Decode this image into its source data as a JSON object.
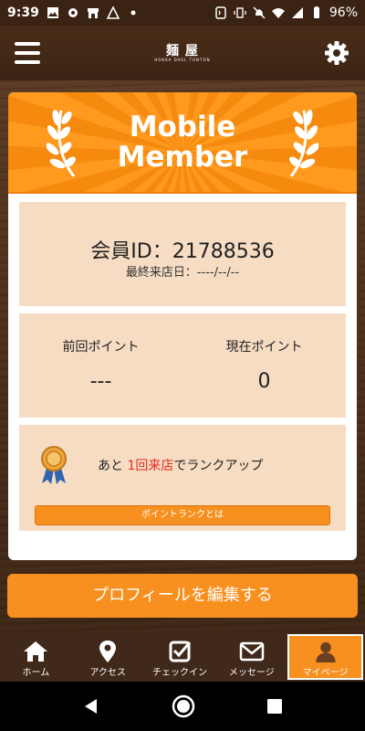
{
  "status_bar": {
    "time": "9:39",
    "battery": "96%"
  },
  "header": {
    "logo_main": "麺 屋",
    "logo_sub": "HOKKA DASL TONTON"
  },
  "banner": {
    "title_line1": "Mobile",
    "title_line2": "Member"
  },
  "member": {
    "id_text": "会員ID：21788536",
    "last_visit": "最終来店日：----/--/--"
  },
  "points": {
    "previous_label": "前回ポイント",
    "previous_value": "---",
    "current_label": "現在ポイント",
    "current_value": "0"
  },
  "rank": {
    "text_before": "あと ",
    "text_highlight": "1回来店",
    "text_after": "でランクアップ",
    "button_label": "ポイントランクとは"
  },
  "edit_profile_label": "プロフィールを編集する",
  "bottom_nav": {
    "items": [
      {
        "label": "ホーム",
        "icon": "home-icon"
      },
      {
        "label": "アクセス",
        "icon": "map-pin-icon"
      },
      {
        "label": "チェックイン",
        "icon": "checkbox-icon"
      },
      {
        "label": "メッセージ",
        "icon": "mail-icon"
      },
      {
        "label": "マイページ",
        "icon": "user-icon"
      }
    ],
    "active_index": 4
  },
  "colors": {
    "accent": "#f7901e",
    "header_bg": "#3b2414",
    "panel_bg": "#f6dcc3",
    "highlight_red": "#e52a1f"
  }
}
